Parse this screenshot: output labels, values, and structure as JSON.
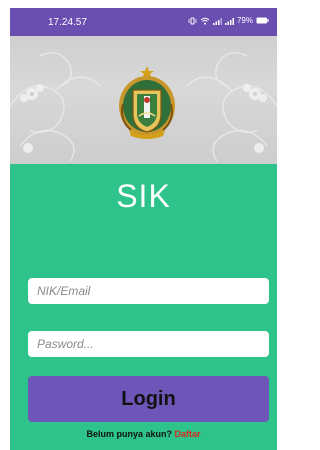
{
  "status_bar": {
    "time": "17.24.57",
    "battery": "79%",
    "icons": [
      "vibrate-icon",
      "wifi-icon",
      "signal-icon",
      "signal-icon",
      "battery-icon"
    ]
  },
  "header": {
    "emblem": "coat-of-arms-icon"
  },
  "app": {
    "title": "SIK"
  },
  "form": {
    "nik_placeholder": "NIK/Email",
    "password_placeholder": "Pasword...",
    "login_label": "Login"
  },
  "register": {
    "prompt": "Belum punya akun?",
    "link_label": "Daftar"
  },
  "colors": {
    "status_bar": "#6b4fb0",
    "background": "#2dc38a",
    "button": "#6e55b8",
    "link": "#d62a1e"
  }
}
